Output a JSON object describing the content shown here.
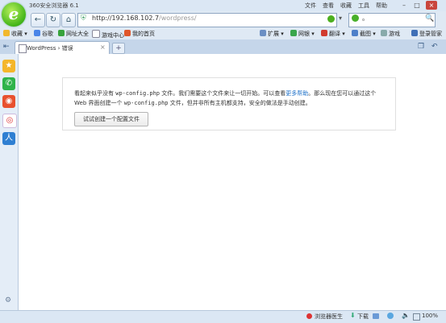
{
  "window": {
    "title": "360安全浏览器 6.1",
    "menu": [
      "文件",
      "查看",
      "收藏",
      "工具",
      "帮助"
    ],
    "controls": {
      "minimize": "–",
      "maximize": "□",
      "close": "×"
    }
  },
  "nav": {
    "back_icon": "←",
    "refresh_icon": "↻",
    "home_icon": "⌂",
    "shield_icon": "⛨",
    "address_host": "http://192.168.102.7",
    "address_path": "/wordpress/",
    "search_value": "。"
  },
  "bookmarks": {
    "left": [
      "收藏",
      "谷歌",
      "网址大全",
      "游戏中心",
      "我的首页"
    ],
    "right": [
      "扩展",
      "网银",
      "翻译",
      "截图",
      "游戏",
      "登录管家"
    ]
  },
  "tabs": [
    {
      "label": "WordPress › 错误"
    }
  ],
  "new_tab": "+",
  "sidebar": {
    "icons": [
      "star-icon",
      "phone-icon",
      "weibo-icon",
      "target-icon",
      "person-icon"
    ]
  },
  "content": {
    "message_part1": "看起来似乎没有",
    "message_code1": "wp-config.php",
    "message_part2": "文件。我们需要这个文件来让一切开始。可以查看",
    "message_link": "更多帮助",
    "message_part3": "。那么现在您可以通过这个 Web 界面创建一个",
    "message_code2": "wp-config.php",
    "message_part4": "文件，但并非所有主机都支持，安全的做法是手动创建。",
    "button_label": "试试创建一个配置文件"
  },
  "status": {
    "doctor": "浏览器医生",
    "download": "下载",
    "zoom": "100%"
  },
  "colors": {
    "accent": "#1b6fc8",
    "chrome": "#dbe7f4",
    "close": "#c9463d"
  }
}
